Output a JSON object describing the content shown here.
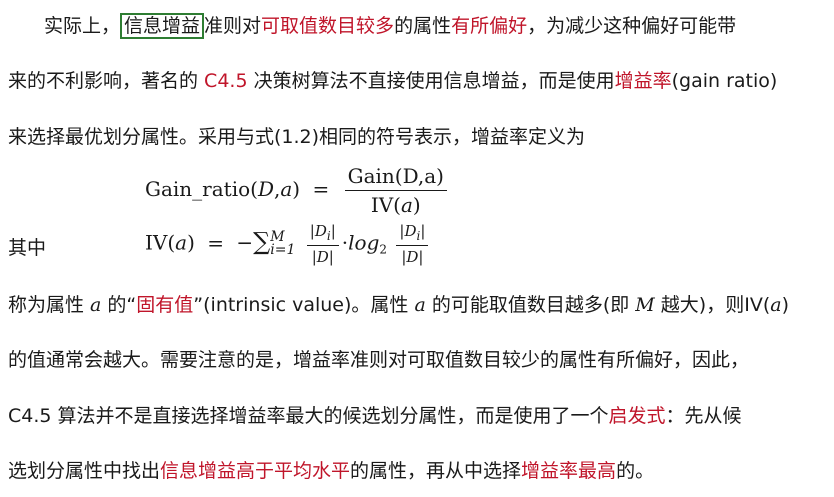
{
  "line1": {
    "a": "实际上，",
    "box": "信息增益",
    "b": "准则对",
    "c": "可取值数目较多",
    "d": "的属性",
    "e": "有所偏好",
    "f": "，为减少这种偏好可能带"
  },
  "line2": {
    "a": "来的不利影响，著名的 ",
    "b": "C4.5",
    "c": " 决策树算法不直接使用信息增益，而是使用",
    "d": "增益率",
    "e": "(gain ratio)"
  },
  "line3": {
    "a": "来选择最优划分属性。采用与式(1.2)相同的符号表示，增益率定义为"
  },
  "eq1": {
    "lhs": "Gain_ratio(",
    "D": "D",
    "comma": ",",
    "a": "a",
    "rpar": ")",
    "eq": "=",
    "num": "Gain(D,a)",
    "den_pre": "IV(",
    "den_a": "a",
    "den_post": ")"
  },
  "eq2": {
    "prefix": "其中",
    "lhs_pre": "IV(",
    "lhs_a": "a",
    "lhs_post": ")",
    "eq": "=",
    "minus": "−",
    "sum": "∑",
    "sub": "i=1",
    "sup": "M",
    "f1_num": "|D",
    "f1_num_i": "i",
    "f1_num_close": "|",
    "f1_den": "|D|",
    "dot": "·",
    "log": "log",
    "log_base": "2",
    "f2_num": "|D",
    "f2_num_i": "i",
    "f2_num_close": "|",
    "f2_den": "|D|"
  },
  "line4": {
    "a": "称为属性 ",
    "var": "a",
    "b": " 的“",
    "c": "固有值",
    "d": "”(intrinsic value)。属性 ",
    "var2": "a",
    "e": " 的可能取值数目越多(即 ",
    "var3": "M",
    "f": " 越大)，则IV(",
    "var4": "a",
    "g": ")"
  },
  "line5": {
    "a": "的值通常会越大。需要注意的是，增益率准则对可取值数目较少的属性有所偏好，因此，"
  },
  "line6": {
    "a": "C4.5 算法并不是直接选择增益率最大的候选划分属性，而是使用了一个",
    "b": "启发式",
    "c": "：先从候"
  },
  "line7": {
    "a": "选划分属性中找出",
    "b": "信息增益高于平均水平",
    "c": "的属性，再从中选择",
    "d": "增益率最高",
    "e": "的。"
  }
}
